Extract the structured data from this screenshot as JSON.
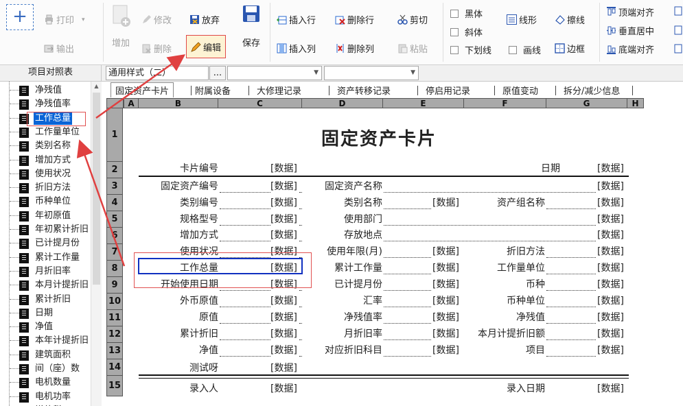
{
  "toolbar": {
    "add": "+",
    "print": "打印",
    "export": "输出",
    "new": "增加",
    "modify": "修改",
    "delete": "删除",
    "discard": "放弃",
    "edit": "编辑",
    "save": "保存",
    "insert_row": "插入行",
    "delete_row": "删除行",
    "insert_col": "插入列",
    "delete_col": "删除列",
    "cut": "剪切",
    "paste": "粘贴",
    "bold": "黑体",
    "italic": "斜体",
    "underline": "下划线",
    "draw_line": "画线",
    "line_style": "线形",
    "erase_line": "擦线",
    "border": "边框",
    "align_top": "顶端对齐",
    "align_vcenter": "垂直居中",
    "align_bottom": "底端对齐"
  },
  "bar2": {
    "tree_title": "项目对照表",
    "style_combo": "通用样式（二）",
    "ellipsis": "..."
  },
  "tree_items": [
    "净残值",
    "净残值率",
    "工作总量",
    "工作量单位",
    "类别名称",
    "增加方式",
    "使用状况",
    "折旧方法",
    "币种单位",
    "年初原值",
    "年初累计折旧",
    "已计提月份",
    "累计工作量",
    "月折旧率",
    "本月计提折旧",
    "累计折旧",
    "日期",
    "净值",
    "本年计提折旧",
    "建筑面积",
    "间（座）数",
    "电机数量",
    "电机功率",
    "增值税"
  ],
  "tabs": [
    "固定资产卡片",
    "附属设备",
    "大修理记录",
    "资产转移记录",
    "停启用记录",
    "原值变动",
    "拆分/减少信息"
  ],
  "col_headers": [
    "A",
    "B",
    "C",
    "D",
    "E",
    "F",
    "G",
    "H"
  ],
  "row_headers": [
    "1",
    "2",
    "3",
    "4",
    "5",
    "6",
    "7",
    "8",
    "9",
    "10",
    "11",
    "12",
    "13",
    "14",
    "15"
  ],
  "sheet": {
    "title": "固定资产卡片",
    "data": "[数据]",
    "r2": {
      "a": "卡片编号",
      "b": "日期"
    },
    "r3": {
      "a": "固定资产编号",
      "b": "固定资产名称"
    },
    "r4": {
      "a": "类别编号",
      "b": "类别名称",
      "c": "资产组名称"
    },
    "r5": {
      "a": "规格型号",
      "b": "使用部门"
    },
    "r6": {
      "a": "增加方式",
      "b": "存放地点"
    },
    "r7": {
      "a": "使用状况",
      "b": "使用年限(月)",
      "c": "折旧方法"
    },
    "r8": {
      "a": "工作总量",
      "b": "累计工作量",
      "c": "工作量单位"
    },
    "r9": {
      "a": "开始使用日期",
      "b": "已计提月份",
      "c": "币种"
    },
    "r10": {
      "a": "外币原值",
      "b": "汇率",
      "c": "币种单位"
    },
    "r11": {
      "a": "原值",
      "b": "净残值率",
      "c": "净残值"
    },
    "r12": {
      "a": "累计折旧",
      "b": "月折旧率",
      "c": "本月计提折旧额"
    },
    "r13": {
      "a": "净值",
      "b": "对应折旧科目",
      "c": "项目"
    },
    "r14": {
      "a": "测试呀"
    },
    "r15": {
      "a": "录入人",
      "b": "录入日期"
    }
  }
}
